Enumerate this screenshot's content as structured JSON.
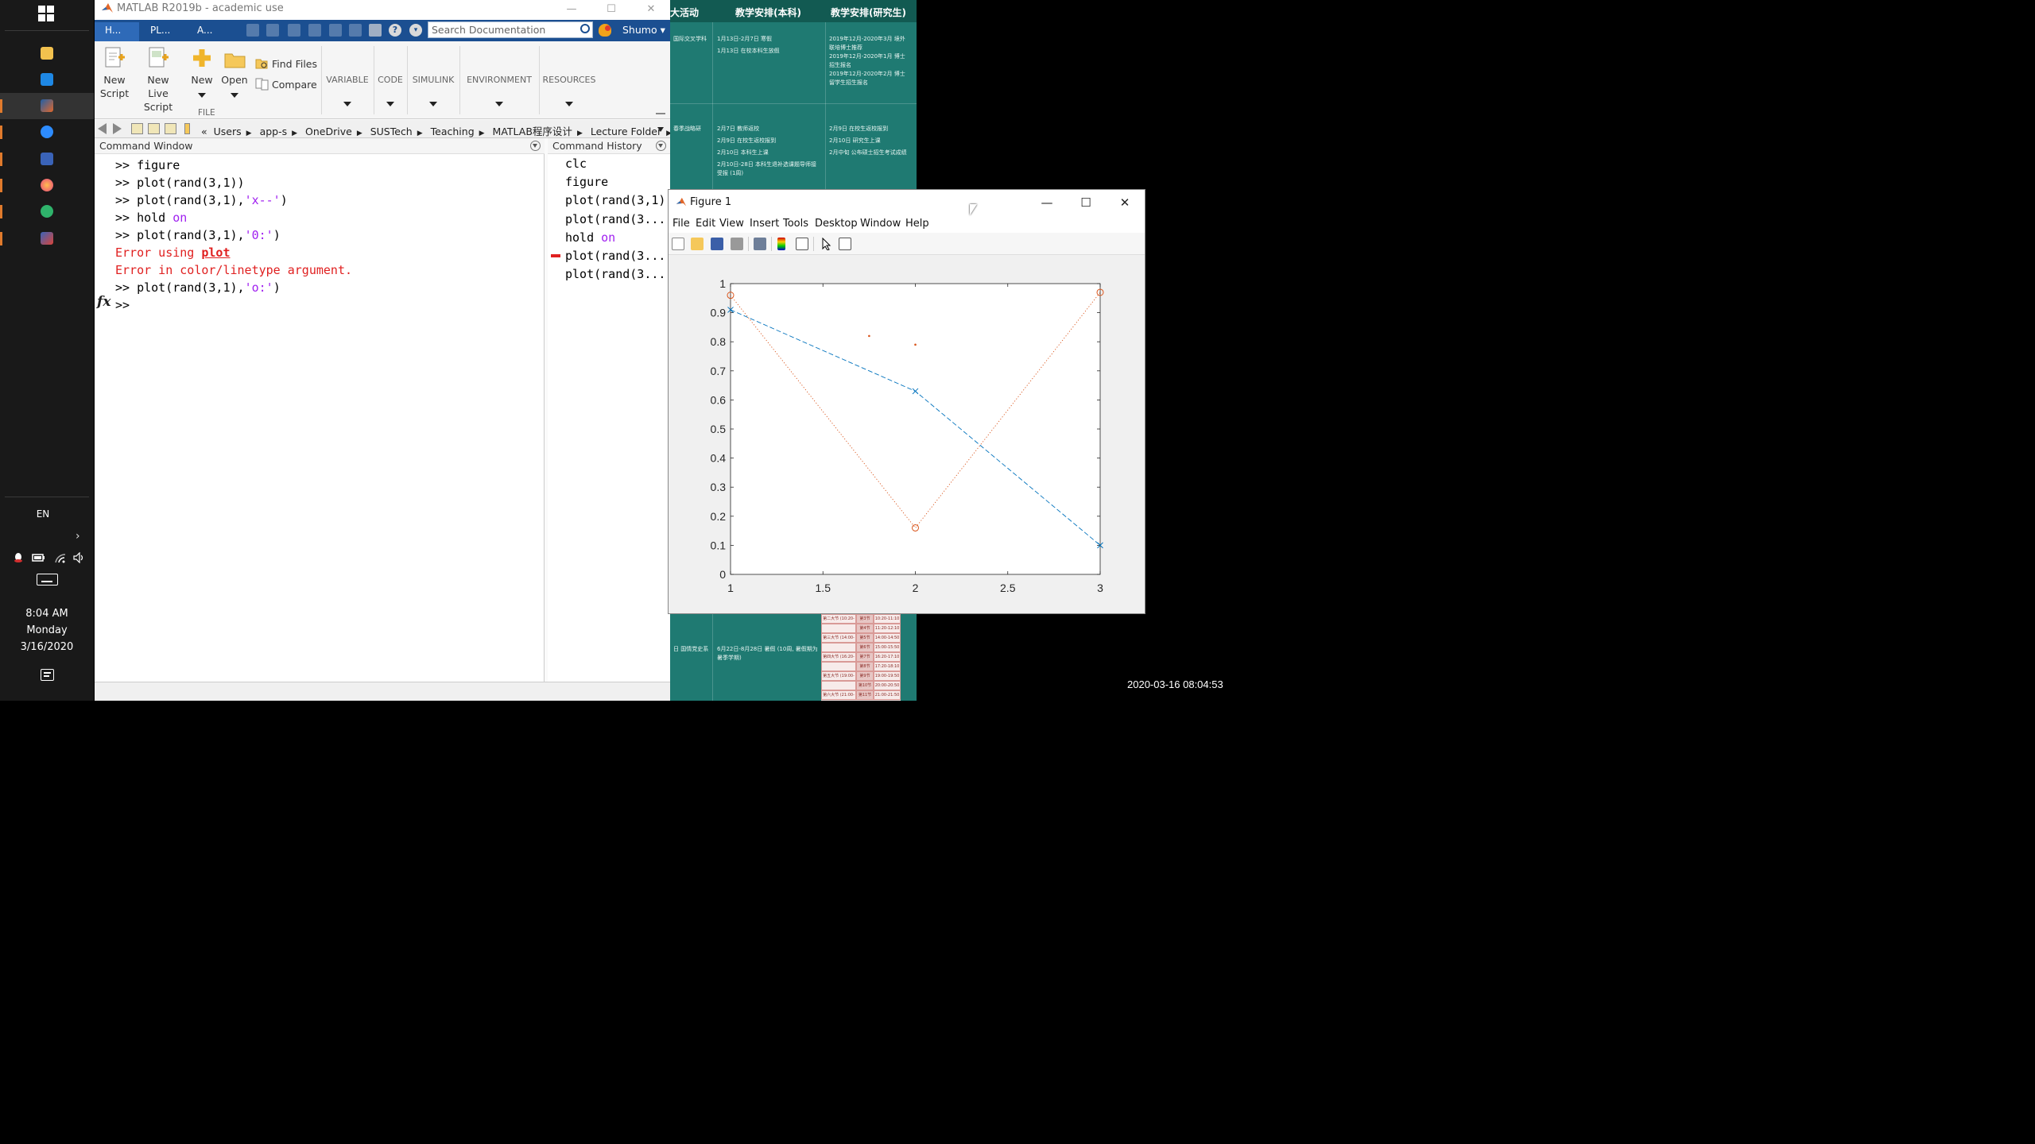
{
  "taskbar": {
    "language": "EN",
    "time": "8:04 AM",
    "day": "Monday",
    "date": "3/16/2020",
    "pinned_apps": [
      "file-explorer-icon",
      "store-icon",
      "matlab-icon",
      "zoom-icon",
      "visio-icon",
      "firefox-icon",
      "app-icon",
      "app-icon"
    ]
  },
  "webpage": {
    "headers": [
      "大活动",
      "教学安排(本科)",
      "教学安排(研究生)"
    ],
    "row1": {
      "col0": "国际交叉学科",
      "col1": [
        "1月13日-2月7日 寒假",
        "1月13日 在校本科生放假"
      ],
      "col2": [
        "2019年12月-2020年3月 境外联培博士推荐",
        "2019年12月-2020年1月 博士招生报名",
        "2019年12月-2020年2月 博士留学生招生报名"
      ]
    },
    "row2": {
      "col0": "春季战略研",
      "col1": [
        "2月7日 教师返校",
        "2月9日 在校生返校报到",
        "2月10日 本科生上课",
        "2月10日-28日 本科生退补选课题导师接受报 (1周)"
      ],
      "col2": [
        "2月9日 在校生返校报到",
        "2月10日 研究生上课",
        "2月中旬 公布硕士招生考试成绩"
      ]
    },
    "row3": {
      "col0": "日 国情党史系",
      "col1": [
        "6月22日-8月28日 暑假 (10周, 暑假期为暑季学期)"
      ]
    },
    "schedule": [
      [
        "第二大节 (10:20-12:10)",
        "第3节",
        "10:20-11:10"
      ],
      [
        "",
        "第4节",
        "11:20-12:10"
      ],
      [
        "第三大节 (14:00-15:50)",
        "第5节",
        "14:00-14:50"
      ],
      [
        "",
        "第6节",
        "15:00-15:50"
      ],
      [
        "第四大节 (16:20-18:10)",
        "第7节",
        "16:20-17:10"
      ],
      [
        "",
        "第8节",
        "17:20-18:10"
      ],
      [
        "第五大节 (19:00-20:50)",
        "第9节",
        "19:00-19:50"
      ],
      [
        "",
        "第10节",
        "20:00-20:50"
      ],
      [
        "第六大节 (21:00-21:50)",
        "第11节",
        "21:00-21:50"
      ]
    ]
  },
  "matlab": {
    "title": "MATLAB R2019b - academic use",
    "tabs": [
      "H...",
      "PL...",
      "A..."
    ],
    "search_placeholder": "Search Documentation",
    "user": "Shumo",
    "ribbon": {
      "new_script_1": "New",
      "new_script_2": "Script",
      "new_live_1": "New",
      "new_live_2": "Live Script",
      "new": "New",
      "open": "Open",
      "find_files": "Find Files",
      "compare": "Compare",
      "section_file": "FILE",
      "variable": "VARIABLE",
      "code": "CODE",
      "simulink": "SIMULINK",
      "environment": "ENVIRONMENT",
      "resources": "RESOURCES"
    },
    "address": {
      "prefix": "«",
      "crumbs": [
        "Users",
        "app-s",
        "OneDrive",
        "SUSTech",
        "Teaching",
        "MATLAB程序设计",
        "Lecture Folder"
      ]
    },
    "command_window": {
      "title": "Command Window",
      "lines": [
        {
          "prompt": ">> ",
          "code": "figure"
        },
        {
          "prompt": ">> ",
          "code": "plot(rand(3,1))"
        },
        {
          "prompt": ">> ",
          "code": "plot(rand(3,1),",
          "str": "'x--'",
          "tail": ")"
        },
        {
          "prompt": ">> ",
          "code": "hold ",
          "str": "on",
          "tail": ""
        },
        {
          "prompt": ">> ",
          "code": "plot(rand(3,1),",
          "str": "'0:'",
          "tail": ")"
        },
        {
          "error_prefix": "Error using ",
          "error_link": "plot"
        },
        {
          "error_text": "Error in color/linetype argument."
        },
        {
          "prompt": ">> ",
          "code": "plot(rand(3,1),",
          "str": "'o:'",
          "tail": ")"
        },
        {
          "prompt": ">> ",
          "code": ""
        }
      ],
      "fx_label": "fx"
    },
    "command_history": {
      "title": "Command History",
      "lines": [
        "clc",
        "figure",
        "plot(rand(3,1))",
        "plot(rand(3...",
        "hold on",
        "plot(rand(3...",
        "plot(rand(3..."
      ],
      "error_line_index": 5
    }
  },
  "figure": {
    "title": "Figure 1",
    "menu": [
      "File",
      "Edit",
      "View",
      "Insert",
      "Tools",
      "Desktop",
      "Window",
      "Help"
    ],
    "toolbar_icons": [
      "new-figure-icon",
      "open-file-icon",
      "save-icon",
      "print-icon",
      "print-preview-icon",
      "insert-colorbar-icon",
      "insert-legend-icon",
      "edit-plot-icon",
      "property-inspector-icon"
    ]
  },
  "chart_data": {
    "type": "line",
    "x": [
      1,
      2,
      3
    ],
    "xlim": [
      1,
      3
    ],
    "ylim": [
      0,
      1
    ],
    "xticks": [
      "1",
      "1.5",
      "2",
      "2.5",
      "3"
    ],
    "yticks": [
      "0",
      "0.1",
      "0.2",
      "0.3",
      "0.4",
      "0.5",
      "0.6",
      "0.7",
      "0.8",
      "0.9",
      "1"
    ],
    "grid": false,
    "series": [
      {
        "values": [
          0.91,
          0.63,
          0.1
        ],
        "color": "#0072BD",
        "linestyle": "dashed",
        "marker": "x"
      },
      {
        "values": [
          0.82,
          0.79
        ],
        "x": [
          1.75,
          2
        ],
        "color": "#D95319",
        "linestyle": "none",
        "marker": "point"
      },
      {
        "values": [
          0.96,
          0.16,
          0.97
        ],
        "color": "#D95319",
        "linestyle": "dotted",
        "marker": "circle"
      }
    ]
  },
  "screen_timestamp": "2020-03-16 08:04:53"
}
